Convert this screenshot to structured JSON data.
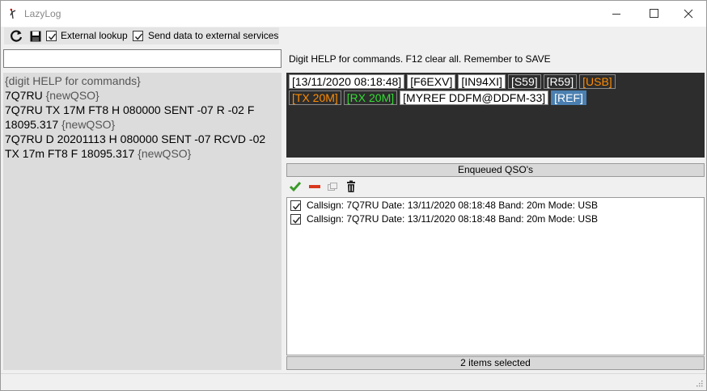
{
  "window": {
    "title": "LazyLog"
  },
  "toolbar": {
    "external_lookup_label": "External lookup",
    "external_lookup_checked": true,
    "send_data_label": "Send data to external services",
    "send_data_checked": true
  },
  "command": {
    "value": "",
    "help_text": "Digit HELP for commands. F12 clear all. Remember to SAVE"
  },
  "log": {
    "line1_text": "{digit HELP for commands}",
    "line2_call": "7Q7RU ",
    "line2_tag": "{newQSO}",
    "line3_text": "7Q7RU TX 17M FT8 H 080000 SENT -07 R -02 F 18095.317 ",
    "line3_tag": "{newQSO}",
    "line4_text": "7Q7RU D 20201113 H 080000 SENT -07 RCVD -02 TX 17m FT8 F 18095.317 ",
    "line4_tag": "{newQSO}"
  },
  "tags": {
    "datetime": "[13/11/2020 08:18:48]",
    "mycall": "[F6EXV]",
    "locator": "[IN94XI]",
    "rst_sent": "[S59]",
    "rst_rcvd": "[R59]",
    "mode": "[USB]",
    "tx_band": "[TX 20M]",
    "rx_band": "[RX 20M]",
    "myref": "[MYREF DDFM@DDFM-33]",
    "ref": "[REF]"
  },
  "queue": {
    "header": "Enqueued QSO's",
    "rows": [
      {
        "text": "Callsign: 7Q7RU Date: 13/11/2020 08:18:48 Band: 20m Mode: USB",
        "checked": true
      },
      {
        "text": "Callsign: 7Q7RU Date: 13/11/2020 08:18:48 Band: 20m Mode: USB",
        "checked": true
      }
    ],
    "status": "2 items selected"
  },
  "colors": {
    "tag_panel_bg": "#2d2d2d",
    "orange": "#ff8c00",
    "green": "#33dd33",
    "ref_blue": "#4a7fb0"
  }
}
